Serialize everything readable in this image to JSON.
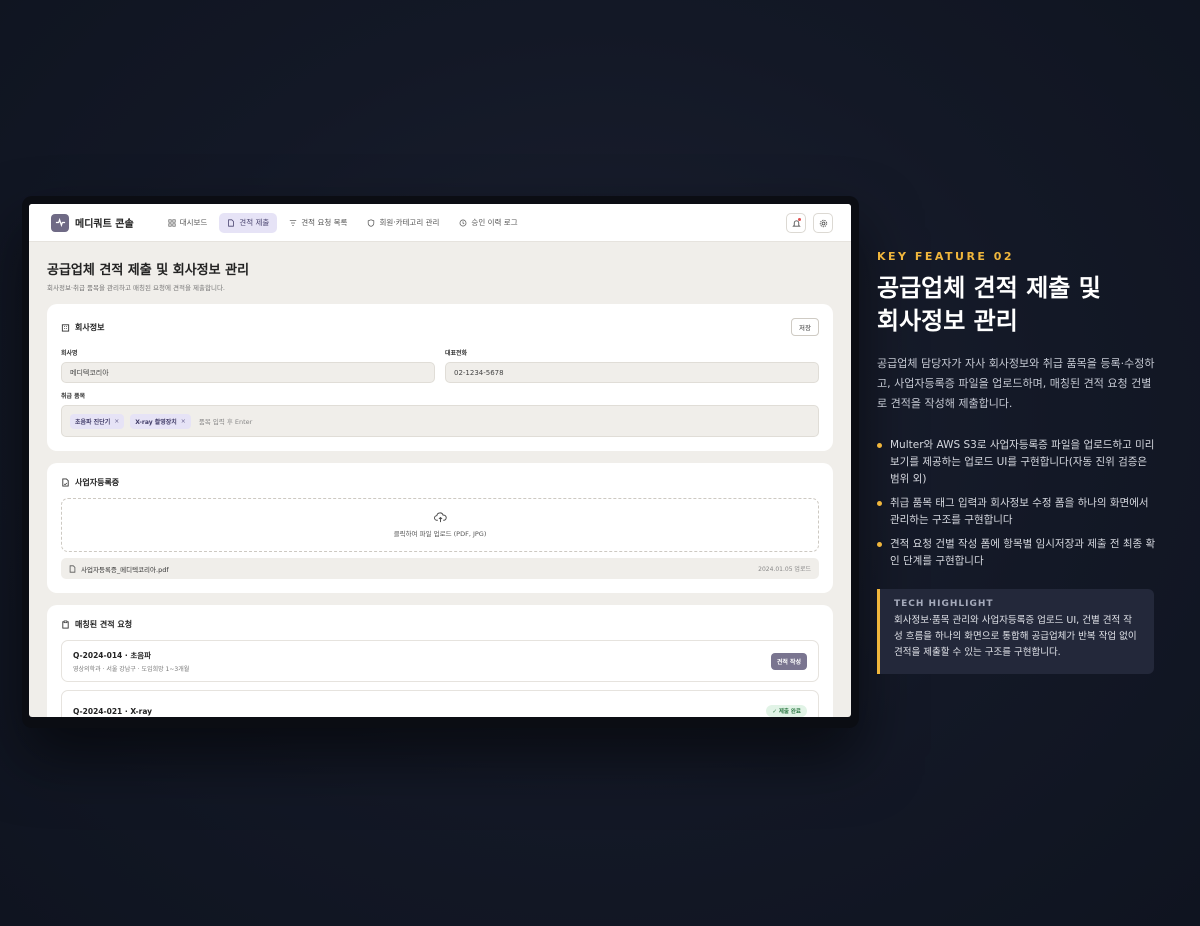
{
  "app": {
    "brand": "메디쿼트 콘솔",
    "nav": [
      {
        "label": "대시보드",
        "active": false,
        "icon": "grid-icon"
      },
      {
        "label": "견적 제출",
        "active": true,
        "icon": "document-icon"
      },
      {
        "label": "견적 요청 목록",
        "active": false,
        "icon": "filter-icon"
      },
      {
        "label": "회원·카테고리 관리",
        "active": false,
        "icon": "shield-icon"
      },
      {
        "label": "승인 이력 로그",
        "active": false,
        "icon": "history-icon"
      }
    ],
    "page_title": "공급업체 견적 제출 및 회사정보 관리",
    "page_subtitle": "회사정보·취급 품목을 관리하고 매칭된 요청에 견적을 제출합니다.",
    "company_card": {
      "title": "회사정보",
      "save_label": "저장",
      "company_name_label": "회사명",
      "company_name_value": "메디텍코리아",
      "phone_label": "대표전화",
      "phone_value": "02-1234-5678",
      "items_label": "취급 품목",
      "tags": [
        "초음파 진단기",
        "X-ray 촬영장치"
      ],
      "tag_placeholder": "품목 입력 후 Enter"
    },
    "license_card": {
      "title": "사업자등록증",
      "upload_text": "클릭하여 파일 업로드 (PDF, JPG)",
      "file_name": "사업자등록증_메디텍코리아.pdf",
      "file_date": "2024.01.05 업로드"
    },
    "requests_card": {
      "title": "매칭된 견적 요청",
      "requests": [
        {
          "id": "Q-2024-014 · 초음파",
          "meta": "영상의학과 · 서울 강남구 · 도입희망 1~3개월",
          "action": "견적 작성"
        },
        {
          "id": "Q-2024-021 · X-ray",
          "meta": "",
          "status": "✓ 제출 완료"
        }
      ]
    }
  },
  "feature": {
    "kicker": "KEY FEATURE 02",
    "title_line1": "공급업체 견적 제출 및",
    "title_line2": "회사정보 관리",
    "description": "공급업체 담당자가 자사 회사정보와 취급 품목을 등록·수정하고, 사업자등록증 파일을 업로드하며, 매칭된 견적 요청 건별로 견적을 작성해 제출합니다.",
    "bullets": [
      "Multer와 AWS S3로 사업자등록증 파일을 업로드하고 미리보기를 제공하는 업로드 UI를 구현합니다(자동 진위 검증은 범위 외)",
      "취급 품목 태그 입력과 회사정보 수정 폼을 하나의 화면에서 관리하는 구조를 구현합니다",
      "견적 요청 건별 작성 폼에 항목별 임시저장과 제출 전 최종 확인 단계를 구현합니다"
    ],
    "tech_label": "TECH HIGHLIGHT",
    "tech_text": "회사정보·품목 관리와 사업자등록증 업로드 UI, 건별 견적 작성 흐름을 하나의 화면으로 통합해 공급업체가 반복 작업 없이 견적을 제출할 수 있는 구조를 구현합니다."
  },
  "colors": {
    "accent": "#f0b63c",
    "nav_active": "#e6e3f6",
    "primary_button": "#7a7590",
    "background": "#131826"
  }
}
